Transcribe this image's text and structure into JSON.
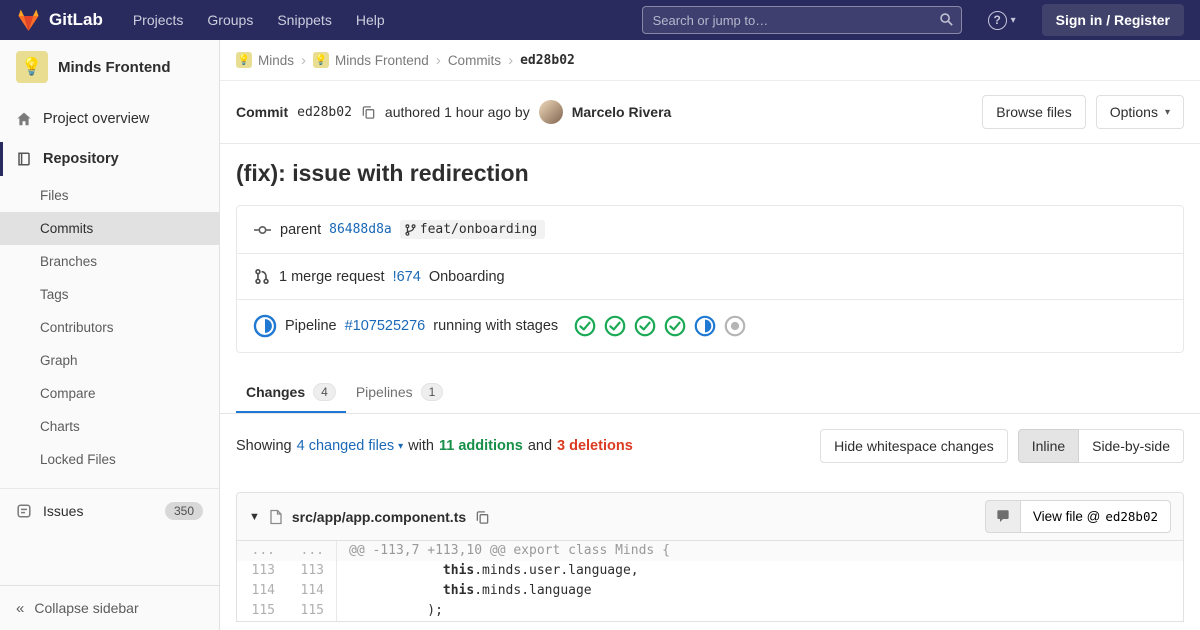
{
  "navbar": {
    "logo_text": "GitLab",
    "items": [
      "Projects",
      "Groups",
      "Snippets",
      "Help"
    ],
    "search_placeholder": "Search or jump to…",
    "sign_in_label": "Sign in / Register"
  },
  "sidebar": {
    "project_avatar": "💡",
    "project_name": "Minds Frontend",
    "overview_label": "Project overview",
    "repository_label": "Repository",
    "repo_items": [
      "Files",
      "Commits",
      "Branches",
      "Tags",
      "Contributors",
      "Graph",
      "Compare",
      "Charts",
      "Locked Files"
    ],
    "active_repo_item": "Commits",
    "issues_label": "Issues",
    "issues_count": "350",
    "collapse_label": "Collapse sidebar"
  },
  "breadcrumb": {
    "avatar": "💡",
    "items": [
      "Minds",
      "Minds Frontend",
      "Commits"
    ],
    "current": "ed28b02"
  },
  "commit": {
    "label": "Commit",
    "sha": "ed28b02",
    "authored_text": "authored 1 hour ago by",
    "author": "Marcelo Rivera",
    "browse_files_label": "Browse files",
    "options_label": "Options",
    "title": "(fix): issue with redirection",
    "parent_label": "parent",
    "parent_sha": "86488d8a",
    "branch": "feat/onboarding",
    "mr_count_text": "1 merge request",
    "mr_link": "!674",
    "mr_name": "Onboarding",
    "pipeline_label": "Pipeline",
    "pipeline_id": "#107525276",
    "pipeline_status_text": "running with stages",
    "pipeline_status": "running",
    "pipeline_stages": [
      "success",
      "success",
      "success",
      "success",
      "running",
      "created"
    ]
  },
  "tabs": {
    "changes_label": "Changes",
    "changes_count": "4",
    "pipelines_label": "Pipelines",
    "pipelines_count": "1"
  },
  "diff_controls": {
    "showing_label": "Showing",
    "changed_files_label": "4 changed files",
    "with_label": "with",
    "additions_label": "11 additions",
    "and_label": "and",
    "deletions_label": "3 deletions",
    "hide_whitespace_label": "Hide whitespace changes",
    "inline_label": "Inline",
    "side_by_side_label": "Side-by-side"
  },
  "diff_file": {
    "path": "src/app/app.component.ts",
    "view_file_prefix": "View file @",
    "view_file_sha": "ed28b02",
    "lines": [
      {
        "old": "...",
        "new": "...",
        "text": "@@ -113,7 +113,10 @@ export class Minds {",
        "type": "hunk"
      },
      {
        "old": "113",
        "new": "113",
        "text": "            this.minds.user.language,",
        "type": "context"
      },
      {
        "old": "114",
        "new": "114",
        "text": "            this.minds.language",
        "type": "context"
      },
      {
        "old": "115",
        "new": "115",
        "text": "          );",
        "type": "context"
      }
    ]
  },
  "colors": {
    "navbar_bg": "#292a5e",
    "link_blue": "#1b69b6",
    "tab_accent": "#1f78d1",
    "success_green": "#1aaa55",
    "running_blue": "#1f78d1",
    "created_gray": "#b5b5b5",
    "additions_text": "#168f48",
    "deletions_text": "#db3b21"
  }
}
